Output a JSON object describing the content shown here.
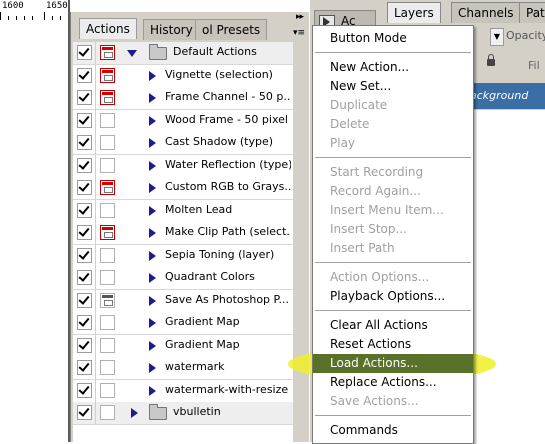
{
  "ruler": {
    "marks": [
      "1600",
      "1650"
    ]
  },
  "actions_panel": {
    "tabs": [
      "Actions",
      "History",
      "Tool Presets"
    ],
    "tab_display": [
      "Actions",
      "History",
      "ol Presets"
    ],
    "scroll_arrows": "▸▸",
    "menu_button": "▾≡",
    "items": [
      {
        "label": "Default Actions",
        "type": "set",
        "expanded": true,
        "checked": true,
        "dialog": "red"
      },
      {
        "label": "Vignette (selection)",
        "checked": true,
        "dialog": "red"
      },
      {
        "label": "Frame Channel - 50 p...",
        "checked": true,
        "dialog": "red"
      },
      {
        "label": "Wood Frame - 50 pixel",
        "checked": true,
        "dialog": "none"
      },
      {
        "label": "Cast Shadow (type)",
        "checked": true,
        "dialog": "none"
      },
      {
        "label": "Water Reflection (type)",
        "checked": true,
        "dialog": "none"
      },
      {
        "label": "Custom RGB to Grays...",
        "checked": true,
        "dialog": "red"
      },
      {
        "label": "Molten Lead",
        "checked": true,
        "dialog": "none"
      },
      {
        "label": "Make Clip Path (select...",
        "checked": true,
        "dialog": "red"
      },
      {
        "label": "Sepia Toning (layer)",
        "checked": true,
        "dialog": "none"
      },
      {
        "label": "Quadrant Colors",
        "checked": true,
        "dialog": "none"
      },
      {
        "label": "Save As Photoshop P...",
        "checked": true,
        "dialog": "grey"
      },
      {
        "label": "Gradient Map",
        "checked": true,
        "dialog": "none"
      },
      {
        "label": "Gradient Map",
        "checked": true,
        "dialog": "none"
      },
      {
        "label": "watermark",
        "checked": true,
        "dialog": "none"
      },
      {
        "label": "watermark-with-resize",
        "checked": true,
        "dialog": "none"
      },
      {
        "label": "vbulletin",
        "type": "set",
        "expanded": false,
        "checked": true,
        "dialog": "none"
      }
    ]
  },
  "layers_panel": {
    "ac_tab": "Ac",
    "tabs": [
      "Layers",
      "Channels",
      "Path"
    ],
    "opacity_label": "Opacity",
    "fill_label": "Fil",
    "background_layer": "ackground"
  },
  "flyout_menu": {
    "items": [
      {
        "label": "Button Mode",
        "enabled": true
      },
      {
        "separator": true
      },
      {
        "label": "New Action...",
        "enabled": true
      },
      {
        "label": "New Set...",
        "enabled": true
      },
      {
        "label": "Duplicate",
        "enabled": false
      },
      {
        "label": "Delete",
        "enabled": false
      },
      {
        "label": "Play",
        "enabled": false
      },
      {
        "separator": true
      },
      {
        "label": "Start Recording",
        "enabled": false
      },
      {
        "label": "Record Again...",
        "enabled": false
      },
      {
        "label": "Insert Menu Item...",
        "enabled": false
      },
      {
        "label": "Insert Stop...",
        "enabled": false
      },
      {
        "label": "Insert Path",
        "enabled": false
      },
      {
        "separator": true
      },
      {
        "label": "Action Options...",
        "enabled": false
      },
      {
        "label": "Playback Options...",
        "enabled": true
      },
      {
        "separator": true
      },
      {
        "label": "Clear All Actions",
        "enabled": true
      },
      {
        "label": "Reset Actions",
        "enabled": true
      },
      {
        "label": "Load Actions...",
        "enabled": true,
        "highlighted": true
      },
      {
        "label": "Replace Actions...",
        "enabled": true
      },
      {
        "label": "Save Actions...",
        "enabled": false
      },
      {
        "separator": true
      },
      {
        "label": "Commands",
        "enabled": true
      }
    ]
  },
  "colors": {
    "highlight_marker": "#eeee28",
    "menu_hover": "#586e2a",
    "selected_layer": "#3a6ea5",
    "dialog_red": "#d40000",
    "triangle_blue": "#1c1c8c"
  }
}
